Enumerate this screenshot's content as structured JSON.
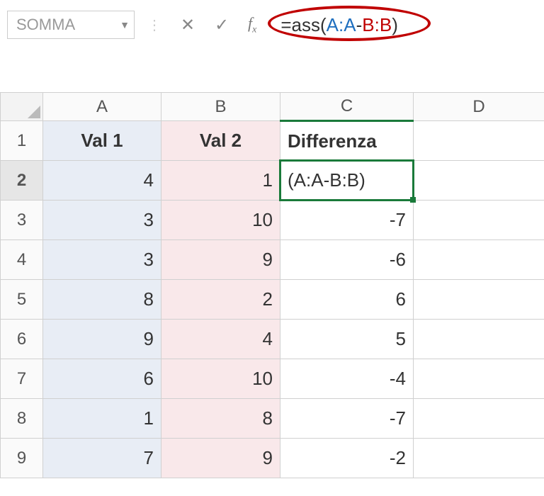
{
  "toolbar": {
    "namebox": "SOMMA",
    "formula_prefix": "=ass",
    "formula_range1": "A:A",
    "formula_op": "-",
    "formula_range2": "B:B"
  },
  "columns": [
    "A",
    "B",
    "C",
    "D"
  ],
  "rows": [
    "1",
    "2",
    "3",
    "4",
    "5",
    "6",
    "7",
    "8",
    "9"
  ],
  "headers": {
    "A": "Val 1",
    "B": "Val 2",
    "C": "Differenza"
  },
  "active_cell_display": "(A:A-B:B)",
  "chart_data": {
    "type": "table",
    "columns": [
      "Val 1",
      "Val 2",
      "Differenza"
    ],
    "rows": [
      {
        "A": 4,
        "B": 1,
        "C": "(A:A-B:B)"
      },
      {
        "A": 3,
        "B": 10,
        "C": -7
      },
      {
        "A": 3,
        "B": 9,
        "C": -6
      },
      {
        "A": 8,
        "B": 2,
        "C": 6
      },
      {
        "A": 9,
        "B": 4,
        "C": 5
      },
      {
        "A": 6,
        "B": 10,
        "C": -4
      },
      {
        "A": 1,
        "B": 8,
        "C": -7
      },
      {
        "A": 7,
        "B": 9,
        "C": -2
      }
    ]
  }
}
